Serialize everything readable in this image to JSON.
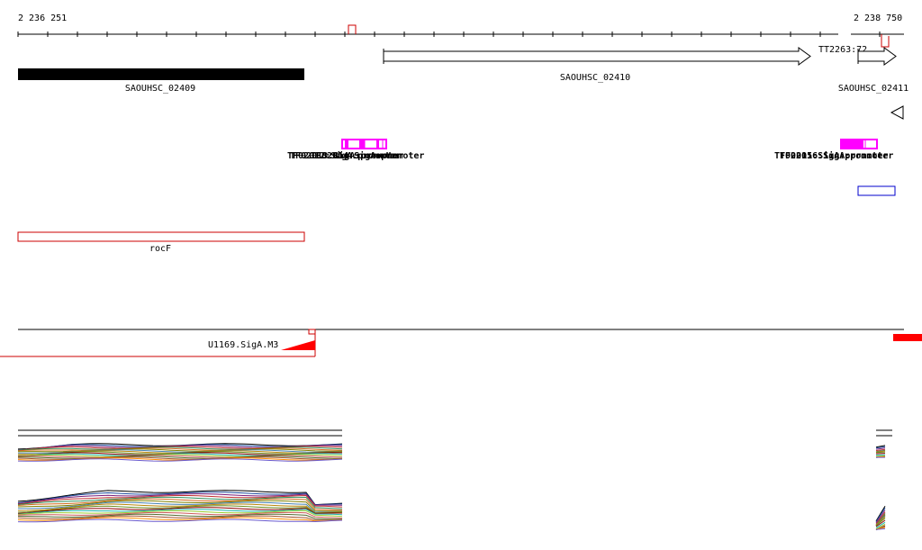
{
  "ruler": {
    "start_label": "2 236 251",
    "end_label": "2 238 750"
  },
  "genes": {
    "g1": "SAOUHSC_02409",
    "g2": "SAOUHSC_02410",
    "g3": "SAOUHSC_02411",
    "tss": "TT2263:72"
  },
  "pink_labels": {
    "left": [
      "TF02012:SigA:promoter",
      "TF02013:SigA:promoter",
      "TF02014:SigA:promoter"
    ],
    "right": [
      "TF02015:SigA:promoter",
      "TF02016:SigA:promoter"
    ]
  },
  "operon": {
    "label": "rocF"
  },
  "motif": {
    "label": "U1169.SigA.M3"
  },
  "colors": {
    "gene_fill": "#000000",
    "pink": "#ff00ff",
    "red": "#ff0000",
    "operon": "#cc0000",
    "blue": "#0000cc"
  },
  "expression_series_colors": [
    "#000000",
    "#1f4e9e",
    "#7a1f7a",
    "#c03030",
    "#2e8b57",
    "#d2691e",
    "#808000",
    "#4682b4",
    "#b8860b",
    "#6b8e23",
    "#8b0000",
    "#20b2aa",
    "#9acd32",
    "#cd5c5c",
    "#556b2f",
    "#a0522d",
    "#ff8c00",
    "#6a5acd"
  ]
}
